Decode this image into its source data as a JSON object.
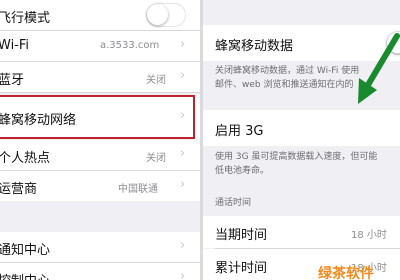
{
  "left": {
    "airplane_mode": {
      "label": "飞行模式",
      "toggle_on": false
    },
    "wifi": {
      "label": "Wi-Fi",
      "value": "a.3533.com"
    },
    "bluetooth": {
      "label": "蓝牙",
      "value": "关闭"
    },
    "cellular_network": {
      "label": "蜂窝移动网络"
    },
    "hotspot": {
      "label": "个人热点",
      "value": "关闭"
    },
    "carrier": {
      "label": "运营商",
      "value": "中国联通"
    },
    "notification_center": {
      "label": "通知中心"
    },
    "control_center": {
      "label": "控制中心"
    }
  },
  "right": {
    "cellular_data": {
      "label": "蜂窝移动数据"
    },
    "cellular_note": {
      "line1": "关闭蜂窝移动数据，通过 Wi-Fi 使用",
      "line2": "邮件、web 浏览和推送通知在内的"
    },
    "enable_3g": {
      "label": "启用 3G"
    },
    "note_3g": {
      "line1": "使用 3G 虽可提高数据载入速度，但可能",
      "line2": "低电池寿命。"
    },
    "call_time_header": "通话时间",
    "current_period": {
      "label": "当期时间",
      "value": "18 小时"
    },
    "lifetime": {
      "label": "累计时间",
      "value": "18 小时"
    }
  },
  "watermark": "绿茶软件",
  "colors": {
    "highlight": "#c0202b",
    "arrow": "#1a8a2e",
    "watermark": "#f28a1e",
    "background": "#efeff4"
  },
  "icons": [
    "chevron-right-icon",
    "toggle-switch",
    "green-arrow-annotation"
  ]
}
